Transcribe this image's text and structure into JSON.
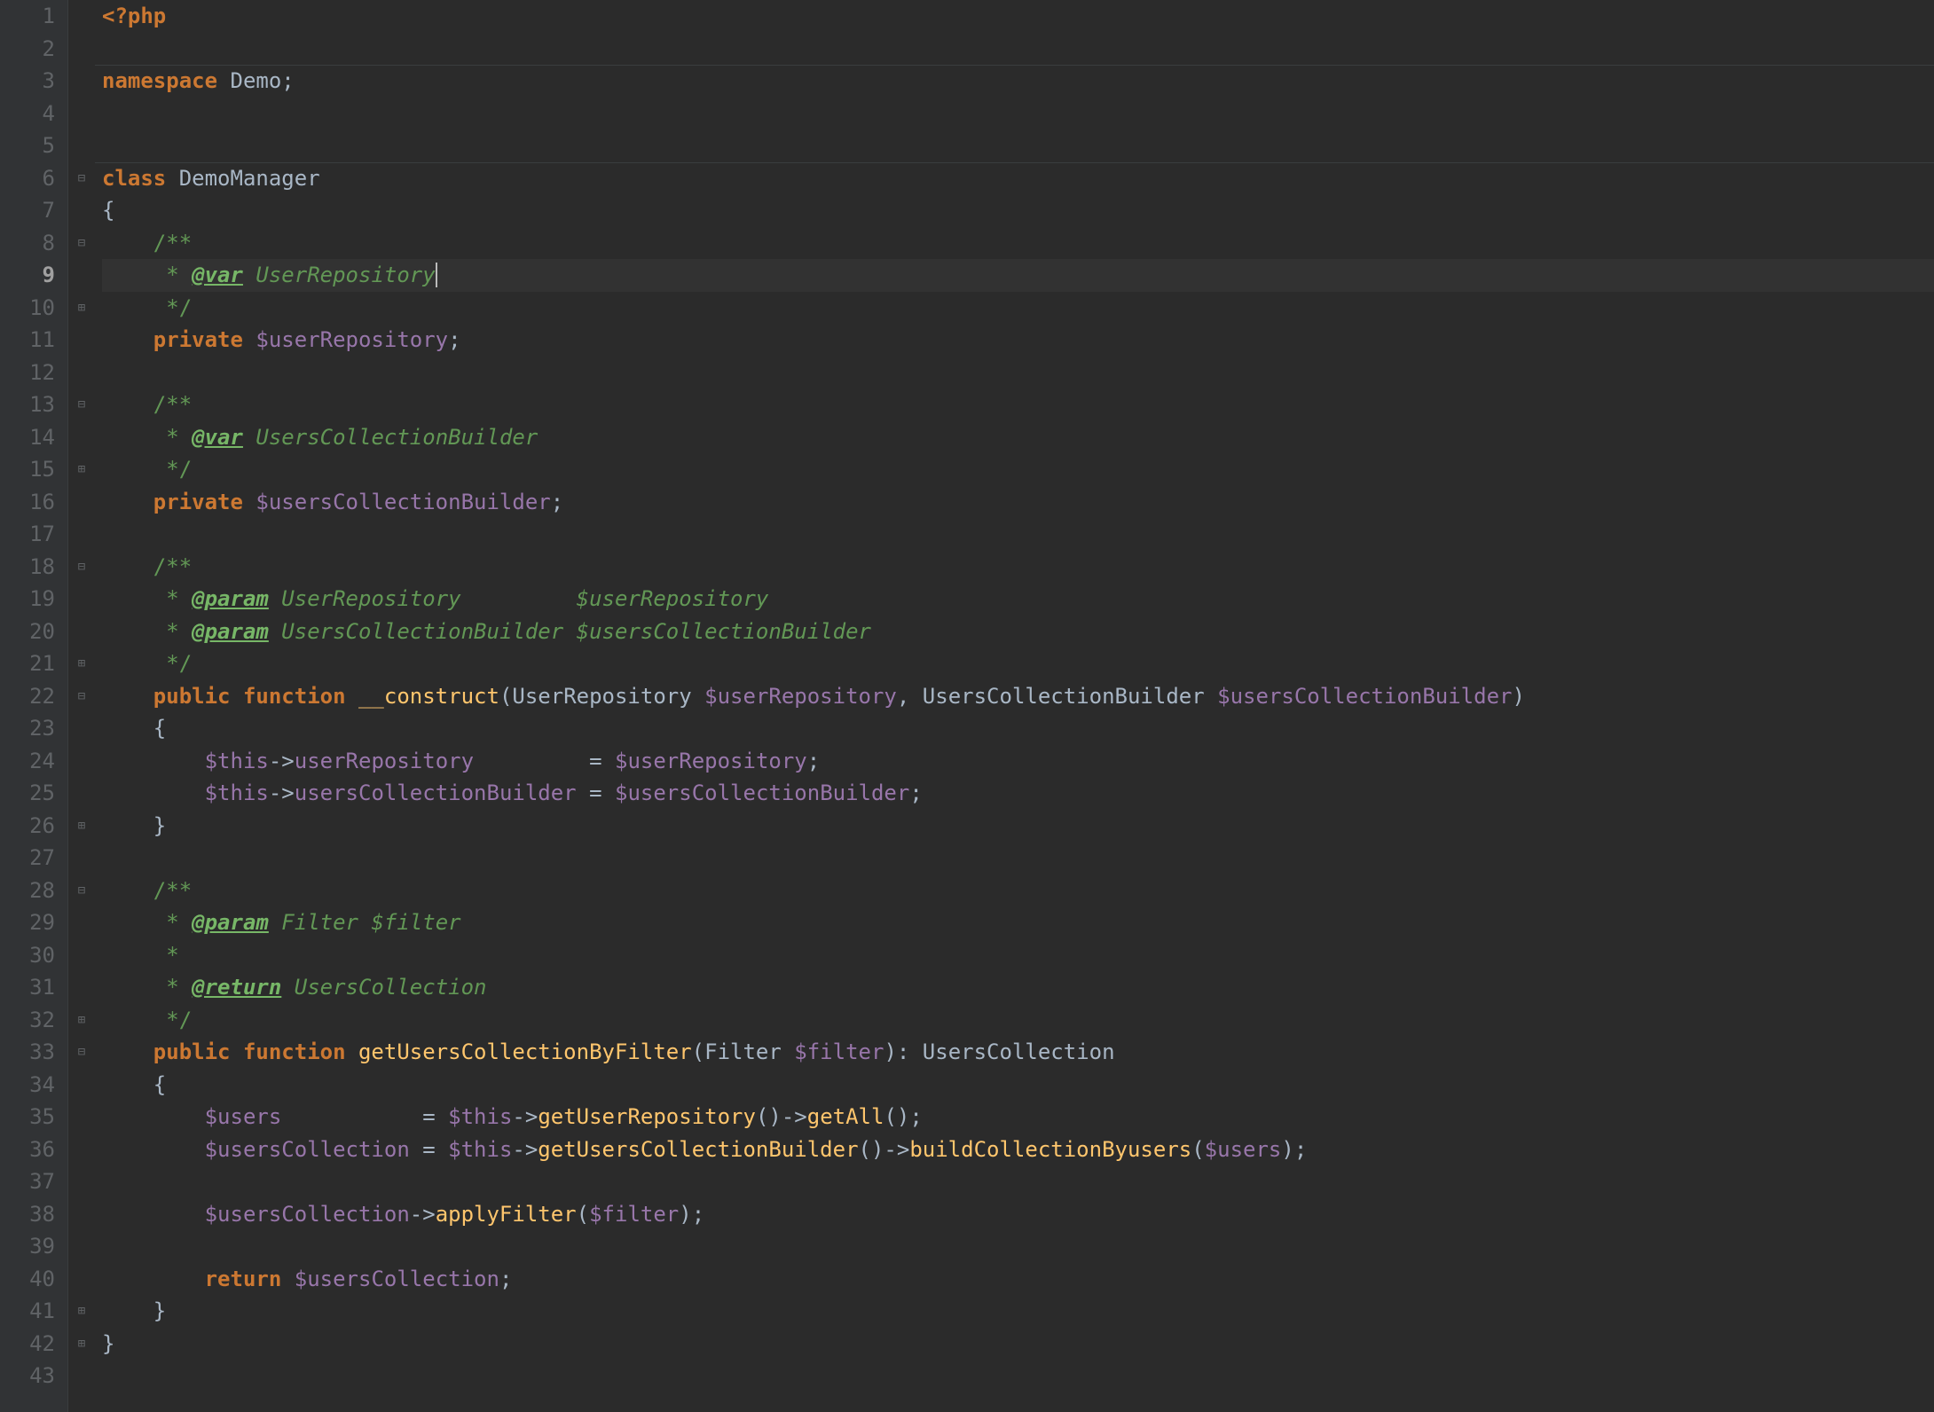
{
  "colors": {
    "background": "#2b2b2b",
    "gutter_bg": "#313335",
    "gutter_fg": "#606366",
    "gutter_cur": "#a0a0a0",
    "highlight_bg": "#323232",
    "keyword": "#cc7832",
    "function": "#ffc66d",
    "variable": "#9876aa",
    "doc": "#629755",
    "text": "#a9b7c6"
  },
  "current_line": 9,
  "horizontal_rules_after_lines": [
    2,
    5
  ],
  "lines": [
    {
      "n": 1,
      "fold": "",
      "tokens": [
        [
          "opentag",
          "<?php"
        ]
      ]
    },
    {
      "n": 2,
      "fold": "",
      "tokens": []
    },
    {
      "n": 3,
      "fold": "",
      "tokens": [
        [
          "kw",
          "namespace "
        ],
        [
          "def",
          "Demo"
        ],
        [
          "punct",
          ";"
        ]
      ]
    },
    {
      "n": 4,
      "fold": "",
      "tokens": []
    },
    {
      "n": 5,
      "fold": "",
      "tokens": []
    },
    {
      "n": 6,
      "fold": "open",
      "tokens": [
        [
          "kw",
          "class "
        ],
        [
          "def",
          "DemoManager"
        ]
      ]
    },
    {
      "n": 7,
      "fold": "",
      "tokens": [
        [
          "brace",
          "{"
        ]
      ]
    },
    {
      "n": 8,
      "fold": "open",
      "tokens": [
        [
          "def",
          "    "
        ],
        [
          "doc",
          "/**"
        ]
      ]
    },
    {
      "n": 9,
      "fold": "",
      "hl": true,
      "tokens": [
        [
          "def",
          "    "
        ],
        [
          "docstar",
          " * "
        ],
        [
          "docb",
          "@var"
        ],
        [
          "doctype",
          " UserRepository"
        ]
      ],
      "caret": true
    },
    {
      "n": 10,
      "fold": "close",
      "tokens": [
        [
          "def",
          "    "
        ],
        [
          "doc",
          " */"
        ]
      ]
    },
    {
      "n": 11,
      "fold": "",
      "tokens": [
        [
          "def",
          "    "
        ],
        [
          "kw",
          "private "
        ],
        [
          "var",
          "$userRepository"
        ],
        [
          "punct",
          ";"
        ]
      ]
    },
    {
      "n": 12,
      "fold": "",
      "tokens": []
    },
    {
      "n": 13,
      "fold": "open",
      "tokens": [
        [
          "def",
          "    "
        ],
        [
          "doc",
          "/**"
        ]
      ]
    },
    {
      "n": 14,
      "fold": "",
      "tokens": [
        [
          "def",
          "    "
        ],
        [
          "docstar",
          " * "
        ],
        [
          "docb",
          "@var"
        ],
        [
          "doctype",
          " UsersCollectionBuilder"
        ]
      ]
    },
    {
      "n": 15,
      "fold": "close",
      "tokens": [
        [
          "def",
          "    "
        ],
        [
          "doc",
          " */"
        ]
      ]
    },
    {
      "n": 16,
      "fold": "",
      "tokens": [
        [
          "def",
          "    "
        ],
        [
          "kw",
          "private "
        ],
        [
          "var",
          "$usersCollectionBuilder"
        ],
        [
          "punct",
          ";"
        ]
      ]
    },
    {
      "n": 17,
      "fold": "",
      "tokens": []
    },
    {
      "n": 18,
      "fold": "open",
      "tokens": [
        [
          "def",
          "    "
        ],
        [
          "doc",
          "/**"
        ]
      ]
    },
    {
      "n": 19,
      "fold": "",
      "tokens": [
        [
          "def",
          "    "
        ],
        [
          "docstar",
          " * "
        ],
        [
          "docb",
          "@param"
        ],
        [
          "doctype",
          " UserRepository         "
        ],
        [
          "docvar",
          "$userRepository"
        ]
      ]
    },
    {
      "n": 20,
      "fold": "",
      "tokens": [
        [
          "def",
          "    "
        ],
        [
          "docstar",
          " * "
        ],
        [
          "docb",
          "@param"
        ],
        [
          "doctype",
          " UsersCollectionBuilder "
        ],
        [
          "docvar",
          "$usersCollectionBuilder"
        ]
      ]
    },
    {
      "n": 21,
      "fold": "close",
      "tokens": [
        [
          "def",
          "    "
        ],
        [
          "doc",
          " */"
        ]
      ]
    },
    {
      "n": 22,
      "fold": "open",
      "tokens": [
        [
          "def",
          "    "
        ],
        [
          "kw",
          "public function "
        ],
        [
          "fn",
          "__construct"
        ],
        [
          "punct",
          "("
        ],
        [
          "def",
          "UserRepository "
        ],
        [
          "var",
          "$userRepository"
        ],
        [
          "punct",
          ", "
        ],
        [
          "def",
          "UsersCollectionBuilder "
        ],
        [
          "var",
          "$usersCollectionBuilder"
        ],
        [
          "punct",
          ")"
        ]
      ]
    },
    {
      "n": 23,
      "fold": "",
      "tokens": [
        [
          "def",
          "    "
        ],
        [
          "brace",
          "{"
        ]
      ]
    },
    {
      "n": 24,
      "fold": "",
      "tokens": [
        [
          "def",
          "        "
        ],
        [
          "var",
          "$this"
        ],
        [
          "punct",
          "->"
        ],
        [
          "var",
          "userRepository"
        ],
        [
          "def",
          "         "
        ],
        [
          "punct",
          "= "
        ],
        [
          "var",
          "$userRepository"
        ],
        [
          "punct",
          ";"
        ]
      ]
    },
    {
      "n": 25,
      "fold": "",
      "tokens": [
        [
          "def",
          "        "
        ],
        [
          "var",
          "$this"
        ],
        [
          "punct",
          "->"
        ],
        [
          "var",
          "usersCollectionBuilder"
        ],
        [
          "def",
          " "
        ],
        [
          "punct",
          "= "
        ],
        [
          "var",
          "$usersCollectionBuilder"
        ],
        [
          "punct",
          ";"
        ]
      ]
    },
    {
      "n": 26,
      "fold": "close",
      "tokens": [
        [
          "def",
          "    "
        ],
        [
          "brace",
          "}"
        ]
      ]
    },
    {
      "n": 27,
      "fold": "",
      "tokens": []
    },
    {
      "n": 28,
      "fold": "open",
      "tokens": [
        [
          "def",
          "    "
        ],
        [
          "doc",
          "/**"
        ]
      ]
    },
    {
      "n": 29,
      "fold": "",
      "tokens": [
        [
          "def",
          "    "
        ],
        [
          "docstar",
          " * "
        ],
        [
          "docb",
          "@param"
        ],
        [
          "doctype",
          " Filter "
        ],
        [
          "docvar",
          "$filter"
        ]
      ]
    },
    {
      "n": 30,
      "fold": "",
      "tokens": [
        [
          "def",
          "    "
        ],
        [
          "docstar",
          " *"
        ]
      ]
    },
    {
      "n": 31,
      "fold": "",
      "tokens": [
        [
          "def",
          "    "
        ],
        [
          "docstar",
          " * "
        ],
        [
          "docb",
          "@return"
        ],
        [
          "doctype",
          " UsersCollection"
        ]
      ]
    },
    {
      "n": 32,
      "fold": "close",
      "tokens": [
        [
          "def",
          "    "
        ],
        [
          "doc",
          " */"
        ]
      ]
    },
    {
      "n": 33,
      "fold": "open",
      "tokens": [
        [
          "def",
          "    "
        ],
        [
          "kw",
          "public function "
        ],
        [
          "fn",
          "getUsersCollectionByFilter"
        ],
        [
          "punct",
          "("
        ],
        [
          "def",
          "Filter "
        ],
        [
          "var",
          "$filter"
        ],
        [
          "punct",
          "): "
        ],
        [
          "def",
          "UsersCollection"
        ]
      ]
    },
    {
      "n": 34,
      "fold": "",
      "tokens": [
        [
          "def",
          "    "
        ],
        [
          "brace",
          "{"
        ]
      ]
    },
    {
      "n": 35,
      "fold": "",
      "tokens": [
        [
          "def",
          "        "
        ],
        [
          "var",
          "$users"
        ],
        [
          "def",
          "           "
        ],
        [
          "punct",
          "= "
        ],
        [
          "var",
          "$this"
        ],
        [
          "punct",
          "->"
        ],
        [
          "fn",
          "getUserRepository"
        ],
        [
          "punct",
          "()->"
        ],
        [
          "fn",
          "getAll"
        ],
        [
          "punct",
          "();"
        ]
      ]
    },
    {
      "n": 36,
      "fold": "",
      "tokens": [
        [
          "def",
          "        "
        ],
        [
          "var",
          "$usersCollection"
        ],
        [
          "def",
          " "
        ],
        [
          "punct",
          "= "
        ],
        [
          "var",
          "$this"
        ],
        [
          "punct",
          "->"
        ],
        [
          "fn",
          "getUsersCollectionBuilder"
        ],
        [
          "punct",
          "()->"
        ],
        [
          "fn",
          "buildCollectionByusers"
        ],
        [
          "punct",
          "("
        ],
        [
          "var",
          "$users"
        ],
        [
          "punct",
          ");"
        ]
      ]
    },
    {
      "n": 37,
      "fold": "",
      "tokens": []
    },
    {
      "n": 38,
      "fold": "",
      "tokens": [
        [
          "def",
          "        "
        ],
        [
          "var",
          "$usersCollection"
        ],
        [
          "punct",
          "->"
        ],
        [
          "fn",
          "applyFilter"
        ],
        [
          "punct",
          "("
        ],
        [
          "var",
          "$filter"
        ],
        [
          "punct",
          ");"
        ]
      ]
    },
    {
      "n": 39,
      "fold": "",
      "tokens": []
    },
    {
      "n": 40,
      "fold": "",
      "tokens": [
        [
          "def",
          "        "
        ],
        [
          "kw",
          "return "
        ],
        [
          "var",
          "$usersCollection"
        ],
        [
          "punct",
          ";"
        ]
      ]
    },
    {
      "n": 41,
      "fold": "close",
      "tokens": [
        [
          "def",
          "    "
        ],
        [
          "brace",
          "}"
        ]
      ]
    },
    {
      "n": 42,
      "fold": "close",
      "tokens": [
        [
          "brace",
          "}"
        ]
      ]
    },
    {
      "n": 43,
      "fold": "",
      "tokens": []
    }
  ],
  "fold_glyphs": {
    "open": "⊟",
    "close": "⊞",
    "mid": ""
  }
}
